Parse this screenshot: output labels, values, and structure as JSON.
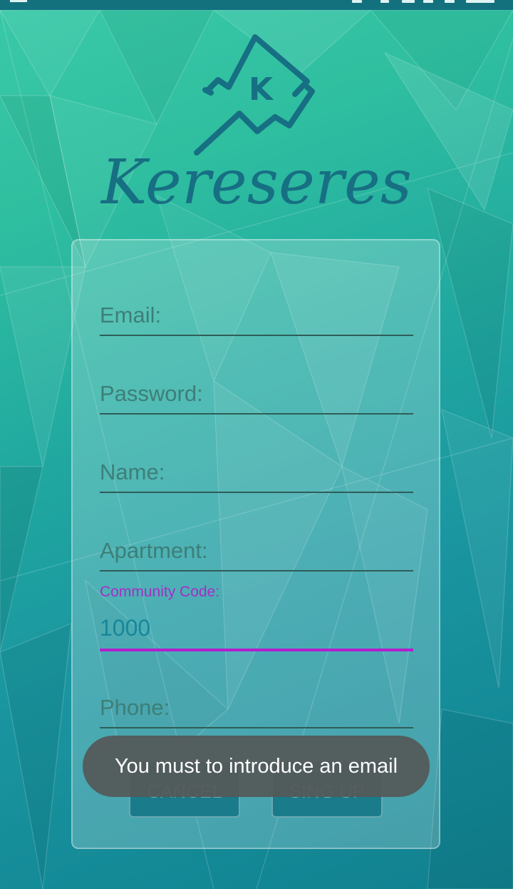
{
  "app": {
    "brand": "Kereseres",
    "logo_letter": "K"
  },
  "form": {
    "email": {
      "placeholder": "Email:"
    },
    "password": {
      "placeholder": "Password:"
    },
    "name": {
      "placeholder": "Name:"
    },
    "apartment": {
      "placeholder": "Apartment:"
    },
    "community_code": {
      "label": "Community Code:",
      "value": "1000"
    },
    "phone": {
      "placeholder": "Phone:"
    }
  },
  "buttons": {
    "cancel": "CANCEL",
    "signup": "SING UP"
  },
  "toast": {
    "message": "You must to introduce an email"
  },
  "colors": {
    "accent": "#b01fcc",
    "brand": "#176f83",
    "status_bar": "#13717e"
  }
}
